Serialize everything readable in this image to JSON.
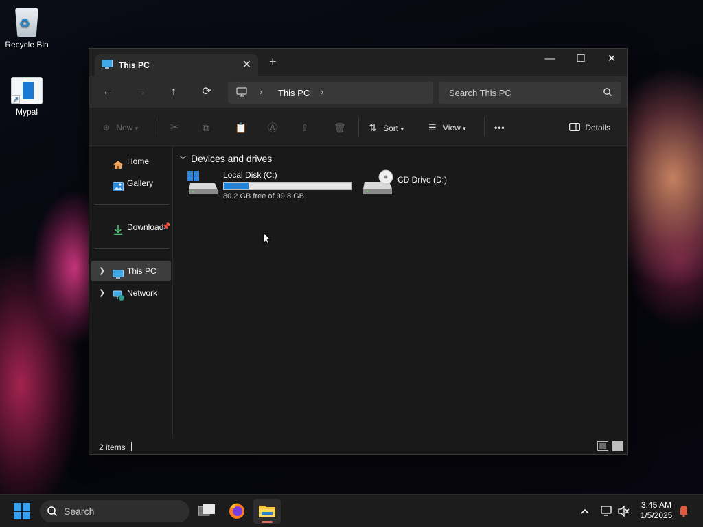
{
  "desktop": {
    "icons": [
      {
        "label": "Recycle Bin",
        "icon": "recycle-bin-icon"
      },
      {
        "label": "Mypal",
        "icon": "mypal-shortcut-icon"
      }
    ]
  },
  "window": {
    "tab_title": "This PC",
    "tab_close": "✕",
    "new_tab": "+",
    "controls": {
      "minimize": "—",
      "maximize": "☐",
      "close": "✕"
    },
    "nav": {
      "back": "←",
      "forward": "→",
      "up": "↑",
      "refresh": "⟳"
    },
    "breadcrumb": {
      "current": "This PC",
      "separator": "›"
    },
    "search": {
      "placeholder": "Search This PC",
      "value": ""
    },
    "commands": {
      "new_label": "New",
      "sort_label": "Sort",
      "view_label": "View",
      "more_label": "•••",
      "details_label": "Details"
    },
    "navpane": {
      "items": [
        {
          "label": "Home",
          "icon": "home-icon"
        },
        {
          "label": "Gallery",
          "icon": "gallery-icon"
        },
        {
          "label": "Downloads",
          "icon": "download-icon",
          "pinned": true
        },
        {
          "label": "This PC",
          "icon": "this-pc-icon",
          "selected": true
        },
        {
          "label": "Network",
          "icon": "network-icon"
        }
      ]
    },
    "content": {
      "group_title": "Devices and drives",
      "drives": [
        {
          "name": "Local Disk (C:)",
          "free_text": "80.2 GB free of 99.8 GB",
          "used_fraction": 0.196
        },
        {
          "name": "CD Drive (D:)"
        }
      ]
    },
    "status": {
      "item_count": "2 items"
    }
  },
  "taskbar": {
    "search_label": "Search",
    "apps": [
      "task-view-icon",
      "firefox-icon",
      "file-explorer-icon"
    ],
    "clock": {
      "time": "3:45 AM",
      "date": "1/5/2025"
    }
  },
  "colors": {
    "accent": "#2384d8",
    "window_bg": "#191919",
    "taskbar_bg": "#1c1c1c"
  }
}
